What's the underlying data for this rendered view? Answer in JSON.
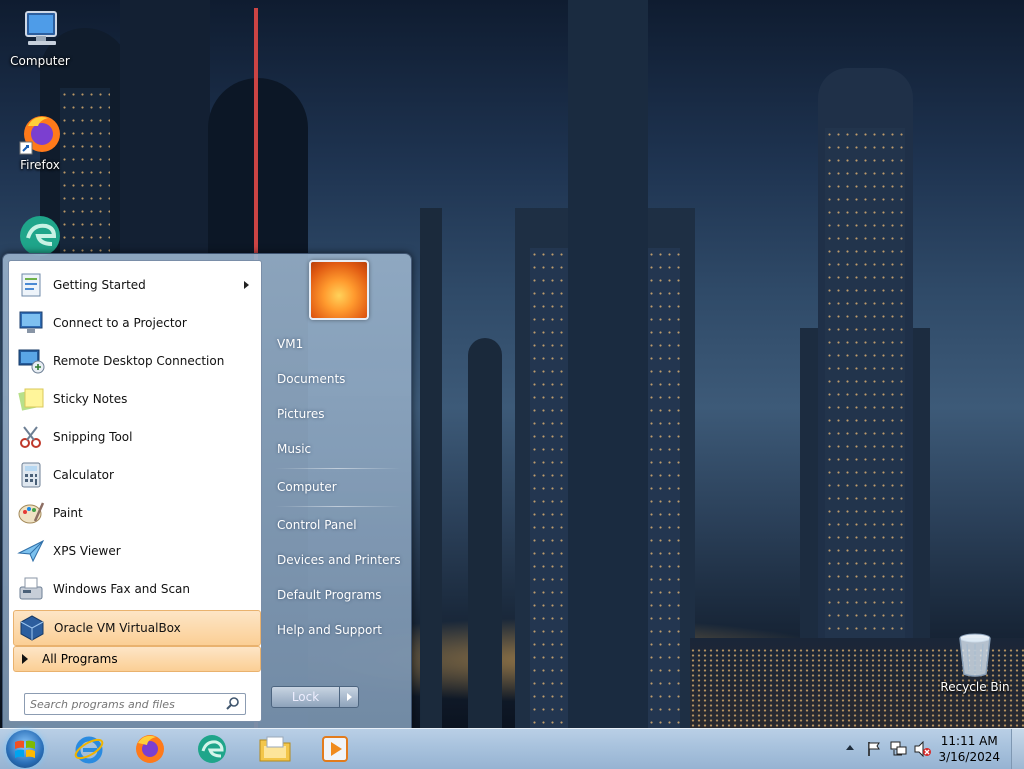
{
  "desktop": {
    "icons": [
      {
        "label": "Computer",
        "icon": "computer-icon"
      },
      {
        "label": "Firefox",
        "icon": "firefox-icon"
      },
      {
        "label": "",
        "icon": "edge-icon"
      },
      {
        "label": "Recycle Bin",
        "icon": "recycle-bin-icon"
      }
    ]
  },
  "start_menu": {
    "programs": [
      {
        "label": "Getting Started",
        "icon": "getting-started-icon",
        "has_submenu": true
      },
      {
        "label": "Connect to a Projector",
        "icon": "projector-icon"
      },
      {
        "label": "Remote Desktop Connection",
        "icon": "remote-desktop-icon"
      },
      {
        "label": "Sticky Notes",
        "icon": "sticky-notes-icon"
      },
      {
        "label": "Snipping Tool",
        "icon": "snipping-tool-icon"
      },
      {
        "label": "Calculator",
        "icon": "calculator-icon"
      },
      {
        "label": "Paint",
        "icon": "paint-icon"
      },
      {
        "label": "XPS Viewer",
        "icon": "xps-viewer-icon"
      },
      {
        "label": "Windows Fax and Scan",
        "icon": "fax-scan-icon"
      },
      {
        "label": "Oracle VM VirtualBox",
        "icon": "virtualbox-icon",
        "highlighted": true
      }
    ],
    "all_programs_label": "All Programs",
    "search_placeholder": "Search programs and files",
    "right_links": [
      "VM1",
      "Documents",
      "Pictures",
      "Music",
      "Computer",
      "Control Panel",
      "Devices and Printers",
      "Default Programs",
      "Help and Support"
    ],
    "lock_label": "Lock"
  },
  "taskbar": {
    "pinned": [
      "internet-explorer-icon",
      "firefox-icon",
      "edge-icon",
      "file-explorer-icon",
      "media-player-icon"
    ],
    "tray_icons": [
      "show-hidden-icon",
      "action-center-flag-icon",
      "network-icon",
      "volume-muted-icon"
    ],
    "clock": {
      "time": "11:11 AM",
      "date": "3/16/2024"
    }
  },
  "colors": {
    "accent": "#fbcf95",
    "taskbar": "#a8c2dd"
  }
}
